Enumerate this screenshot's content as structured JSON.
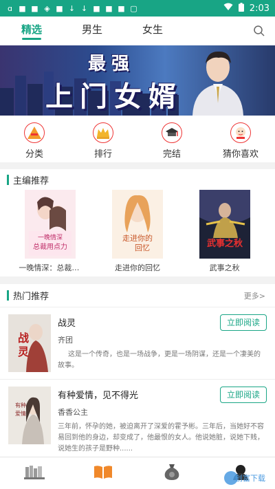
{
  "status_bar": {
    "time": "2:03",
    "left_icons": [
      "notification-icon",
      "app-icon",
      "app-icon",
      "shield-icon",
      "app-icon",
      "download-icon",
      "download-icon",
      "app-icon",
      "app-icon",
      "app-icon",
      "square-icon"
    ]
  },
  "tabs": [
    {
      "label": "精选",
      "active": true
    },
    {
      "label": "男生",
      "active": false
    },
    {
      "label": "女生",
      "active": false
    }
  ],
  "banner": {
    "line1": "最强",
    "line2": "上门女婿"
  },
  "quick_nav": [
    {
      "label": "分类",
      "icon": "category-icon"
    },
    {
      "label": "排行",
      "icon": "ranking-icon"
    },
    {
      "label": "完结",
      "icon": "finished-icon"
    },
    {
      "label": "猜你喜欢",
      "icon": "guess-like-icon"
    }
  ],
  "editor_picks": {
    "title": "主编推荐",
    "books": [
      {
        "title": "一晚情深：总裁用...",
        "cover_text": "一晚情深 总裁用点力"
      },
      {
        "title": "走进你的回忆",
        "cover_text": "走进你的回忆"
      },
      {
        "title": "武事之秋",
        "cover_text": "武事之秋"
      }
    ]
  },
  "hot": {
    "title": "热门推荐",
    "more": "更多>",
    "read_label": "立即阅读",
    "items": [
      {
        "title": "战灵",
        "author": "齐团",
        "desc": "这是一个传奇，也是一场战争，更是一场阴谋，还是一个凄美的故事。",
        "cover_text": "战灵"
      },
      {
        "title": "有种爱情，见不得光",
        "author": "香香公主",
        "desc": "三年前，怀孕的她，被迫离开了深爱的霍予彬。三年后，当她好不容易回到他的身边，却变成了，他最恨的女人。他说她脏，说她下贱，说她生的孩子是野种......",
        "cover_text": "有种爱情 见不得光"
      }
    ]
  },
  "bottom_nav": [
    {
      "icon": "bookshelf-icon"
    },
    {
      "icon": "bookstore-icon"
    },
    {
      "icon": "money-bag-icon"
    },
    {
      "icon": "profile-icon"
    }
  ],
  "watermark": "创富下载",
  "colors": {
    "accent": "#18a585",
    "badge_red": "#e33"
  }
}
